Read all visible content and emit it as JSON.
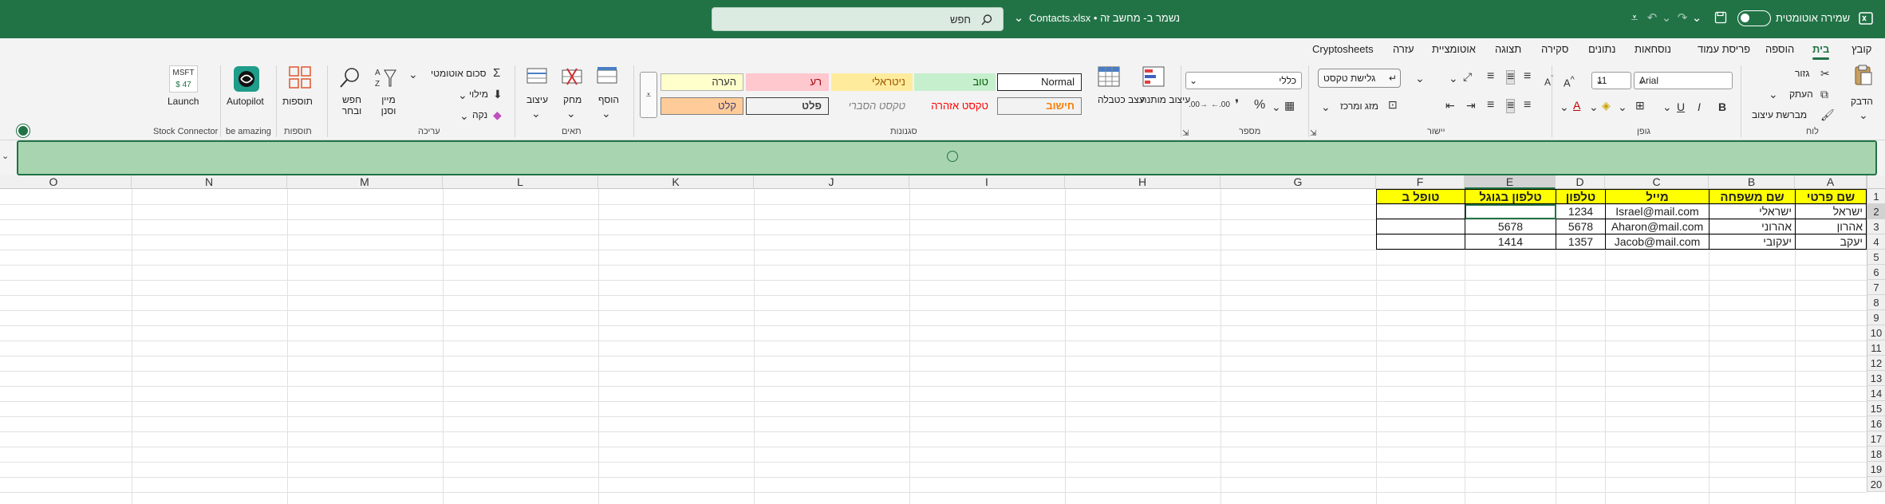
{
  "titlebar": {
    "autosave_label": "שמירה אוטומטית",
    "file_title": "Contacts.xlsx • נשמר ב- מחשב זה",
    "search_placeholder": "חפש"
  },
  "menu": {
    "tabs": [
      "קובץ",
      "בית",
      "הוספה",
      "פריסת עמוד",
      "נוסחאות",
      "נתונים",
      "סקירה",
      "תצוגה",
      "אוטומציית",
      "עזרה",
      "Cryptosheets"
    ]
  },
  "ribbon": {
    "clipboard": {
      "paste": "הדבק",
      "cut": "גזור",
      "copy": "העתק",
      "format_painter": "מברשת עיצוב",
      "label": "לוח"
    },
    "font": {
      "name": "Arial",
      "size": "11",
      "label": "גופן"
    },
    "alignment": {
      "wrap_text": "גלישת טקסט",
      "merge_center": "מזג ומרכז",
      "label": "יישור"
    },
    "number": {
      "format": "כללי",
      "label": "מספר"
    },
    "styles": {
      "conditional_formatting": "עיצוב מותנה",
      "format_as_table": "עצב כטבלה",
      "label": "סגנונות",
      "cells": [
        {
          "name": "Normal",
          "color": "#ffffff",
          "fg": "#000000"
        },
        {
          "name": "טוב",
          "color": "#c6efce",
          "fg": "#006100"
        },
        {
          "name": "ניטראלי",
          "color": "#ffeb9c",
          "fg": "#9c5700"
        },
        {
          "name": "רע",
          "color": "#ffc7ce",
          "fg": "#9c0006"
        },
        {
          "name": "הערה",
          "color": "#ffffcc",
          "fg": "#333333"
        },
        {
          "name": "חישוב",
          "color": "#f2f2f2",
          "fg": "#fa7d00"
        },
        {
          "name": "טקסט אזהרה",
          "color": "#f3f3f3",
          "fg": "#ff0000"
        },
        {
          "name": "טקסט הסברי",
          "color": "#f3f3f3",
          "fg": "#7f7f7f"
        },
        {
          "name": "פלט",
          "color": "#f2f2f2",
          "fg": "#3f3f3f"
        },
        {
          "name": "קלט",
          "color": "#ffcc99",
          "fg": "#3f3f76"
        }
      ]
    },
    "cells": {
      "insert": "הוסף",
      "delete": "מחק",
      "format": "עיצוב",
      "label": "תאים"
    },
    "editing": {
      "autosum": "סכום אוטומטי",
      "fill": "מילוי",
      "clear": "נקה",
      "sort_filter": "מיין וסנן",
      "find_select": "חפש ובחר",
      "label": "עריכה"
    },
    "addins": {
      "addins": "תוספות",
      "label": "תוספות"
    },
    "autopilot": {
      "name": "Autopilot",
      "label": "be amazing"
    },
    "stock": {
      "ticker": "MSFT",
      "price": "$ 47",
      "launch": "Launch",
      "label": "Stock Connector"
    }
  },
  "grid": {
    "columns": [
      "A",
      "B",
      "C",
      "D",
      "E",
      "F",
      "G",
      "H",
      "I",
      "J",
      "K",
      "L",
      "M",
      "N",
      "O"
    ],
    "rows": [
      "1",
      "2",
      "3",
      "4",
      "5",
      "6",
      "7",
      "8",
      "9",
      "10",
      "11",
      "12",
      "13",
      "14",
      "15",
      "16",
      "17",
      "18",
      "19",
      "20"
    ],
    "headers": [
      "שם פרטי",
      "שם משפחה",
      "מייל",
      "טלפון",
      "טלפון בגוגל",
      "טופל ב"
    ],
    "data": [
      [
        "ישראל",
        "ישראלי",
        "Israel@mail.com",
        "1234",
        "",
        ""
      ],
      [
        "אהרון",
        "אהרוני",
        "Aharon@mail.com",
        "5678",
        "5678",
        ""
      ],
      [
        "יעקב",
        "יעקובי",
        "Jacob@mail.com",
        "1357",
        "1414",
        ""
      ]
    ]
  }
}
